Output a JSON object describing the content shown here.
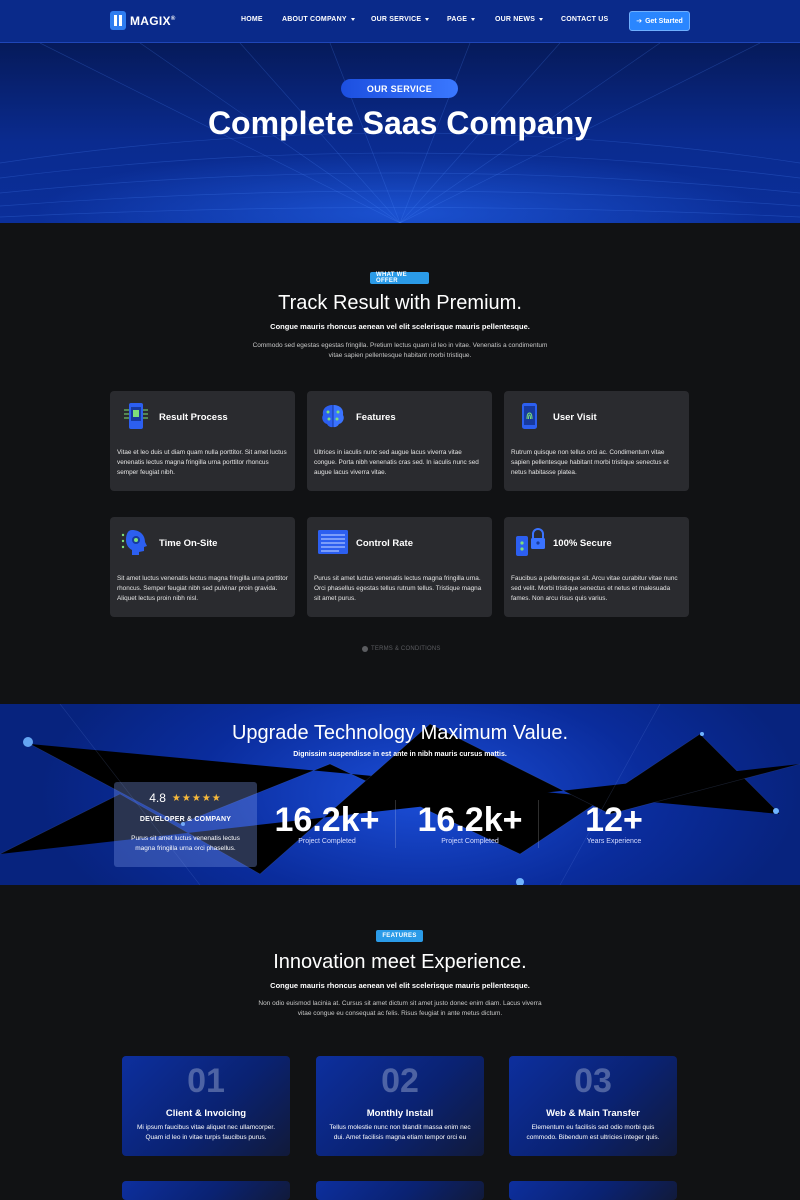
{
  "nav": {
    "logo": "MAGIX",
    "logo_mark": "®",
    "links": [
      "HOME",
      "ABOUT COMPANY",
      "OUR SERVICE",
      "PAGE",
      "OUR NEWS",
      "CONTACT US"
    ],
    "cta": "Get Started"
  },
  "hero": {
    "pill": "OUR SERVICE",
    "title": "Complete Saas Company"
  },
  "offer": {
    "tag": "WHAT WE OFFER",
    "title": "Track Result with Premium.",
    "subtitle": "Congue mauris rhoncus aenean vel elit scelerisque mauris pellentesque.",
    "description": "Commodo sed egestas egestas fringilla. Pretium lectus quam id leo in vitae. Venenatis a condimentum vitae sapien pellentesque habitant morbi tristique.",
    "cards": [
      {
        "title": "Result Process",
        "icon": "phone-chip-icon",
        "text": "Vitae et leo duis ut diam quam nulla porttitor. Sit amet luctus venenatis lectus magna fringilla urna porttitor rhoncus semper feugiat nibh."
      },
      {
        "title": "Features",
        "icon": "brain-circuit-icon",
        "text": "Ultrices in iaculis nunc sed augue lacus viverra vitae congue. Porta nibh venenatis cras sed. In iaculis nunc sed augue lacus viverra vitae."
      },
      {
        "title": "User Visit",
        "icon": "phone-fingerprint-icon",
        "text": "Rutrum quisque non tellus orci ac. Condimentum vitae sapien pellentesque habitant morbi tristique senectus et netus habitasse platea."
      },
      {
        "title": "Time On-Site",
        "icon": "head-circuit-icon",
        "text": "Sit amet luctus venenatis lectus magna fringilla urna porttitor rhoncus. Semper feugiat nibh sed pulvinar proin gravida. Aliquet lectus proin nibh nisl."
      },
      {
        "title": "Control Rate",
        "icon": "server-rack-icon",
        "text": "Purus sit amet luctus venenatis lectus magna fringilla urna. Orci phasellus egestas tellus rutrum tellus. Tristique magna sit amet purus."
      },
      {
        "title": "100% Secure",
        "icon": "phone-lock-icon",
        "text": "Faucibus a pellentesque sit. Arcu vitae curabitur vitae nunc sed velit. Morbi tristique senectus et netus et malesuada fames. Non arcu risus quis varius."
      }
    ],
    "terms": "TERMS & CONDITIONS"
  },
  "band": {
    "title": "Upgrade Technology Maximum Value.",
    "subtitle": "Dignissim suspendisse in est ante in nibh mauris cursus mattis.",
    "rating": {
      "value": "4.8",
      "stars": "★★★★★",
      "label": "DEVELOPER & COMPANY",
      "text": "Purus sit amet luctus venenatis lectus magna fringilla urna orci phasellus."
    },
    "stats": [
      {
        "value": "16.2k+",
        "label": "Project Completed"
      },
      {
        "value": "16.2k+",
        "label": "Project Completed"
      },
      {
        "value": "12+",
        "label": "Years Experience"
      }
    ]
  },
  "features": {
    "tag": "FEATURES",
    "title": "Innovation meet Experience.",
    "subtitle": "Congue mauris rhoncus aenean vel elit scelerisque mauris pellentesque.",
    "description": "Non odio euismod lacinia at. Cursus sit amet dictum sit amet justo donec enim diam. Lacus viverra vitae congue eu consequat ac felis. Risus feugiat in ante metus dictum.",
    "cards": [
      {
        "num": "01",
        "title": "Client & Invoicing",
        "text": "Mi ipsum faucibus vitae aliquet nec ullamcorper. Quam id leo in vitae turpis  faucibus purus."
      },
      {
        "num": "02",
        "title": "Monthly Install",
        "text": "Tellus molestie nunc non blandit massa enim nec dui. Amet facilisis magna etiam tempor orci eu"
      },
      {
        "num": "03",
        "title": "Web & Main Transfer",
        "text": "Elementum eu facilisis sed odio morbi quis commodo. Bibendum est ultricies integer quis."
      }
    ]
  }
}
